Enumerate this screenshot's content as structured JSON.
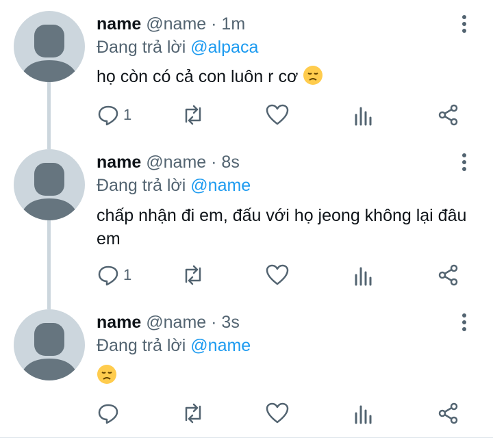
{
  "replying_prefix": "Đang trả lời",
  "tweets": [
    {
      "name": "name",
      "handle": "@name",
      "separator": "·",
      "time": "1m",
      "reply_to": "@alpaca",
      "text": "họ còn có cả con luôn r cơ",
      "emoji": "disappointed-face",
      "reply_count": "1"
    },
    {
      "name": "name",
      "handle": "@name",
      "separator": "·",
      "time": "8s",
      "reply_to": "@name",
      "text": "chấp nhận đi em, đấu với họ jeong không lại đâu em",
      "reply_count": "1"
    },
    {
      "name": "name",
      "handle": "@name",
      "separator": "·",
      "time": "3s",
      "reply_to": "@name",
      "text": "",
      "emoji": "disappointed-face",
      "reply_count": ""
    }
  ],
  "colors": {
    "accent": "#1d9bf0",
    "secondary_text": "#536471",
    "avatar_bg": "#ccd6dd",
    "avatar_fg": "#66757f"
  }
}
